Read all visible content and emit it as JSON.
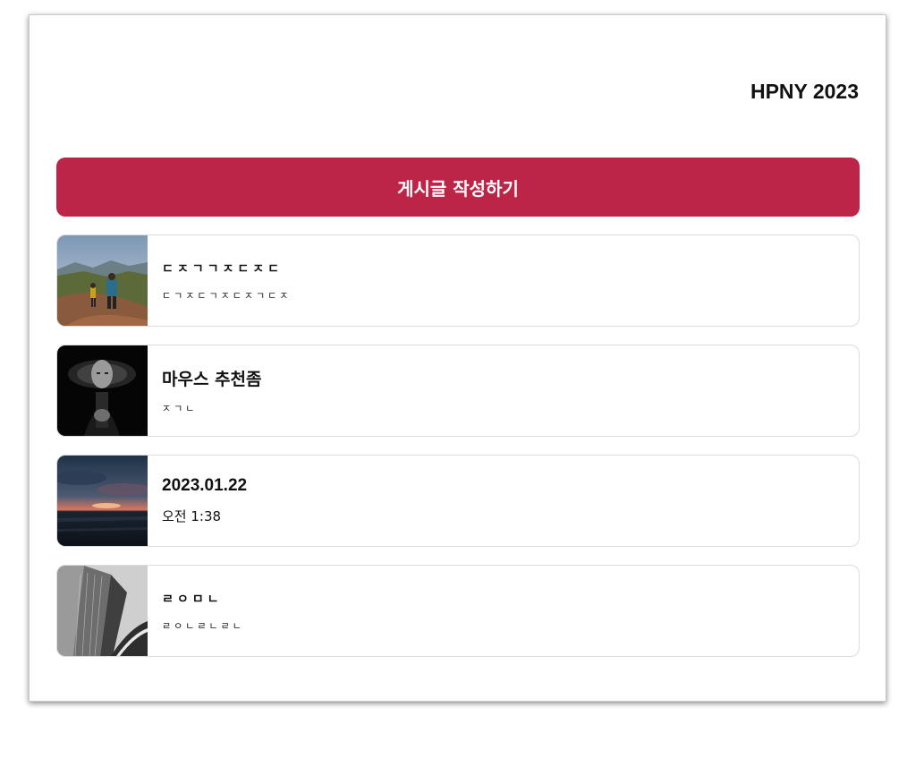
{
  "header": {
    "title": "HPNY 2023"
  },
  "actions": {
    "write_label": "게시글 작성하기",
    "accent_color": "#bc2547"
  },
  "posts": [
    {
      "title": "ㄷㅈㄱㄱㅈㄷㅈㄷ",
      "subtitle": "ㄷㄱㅈㄷㄱㅈㄷㅈㄱㄷㅈ",
      "thumb_icon": "hikers-mountain-photo"
    },
    {
      "title": "마우스 추천좀",
      "subtitle": "ㅈㄱㄴ",
      "thumb_icon": "portrait-motion-blur-photo"
    },
    {
      "title": "2023.01.22",
      "subtitle": "오전 1:38",
      "thumb_icon": "sunset-sea-photo"
    },
    {
      "title": "ㄹㅇㅁㄴ",
      "subtitle": "ㄹㅇㄴㄹㄴㄹㄴ",
      "thumb_icon": "skyscraper-photo"
    }
  ]
}
